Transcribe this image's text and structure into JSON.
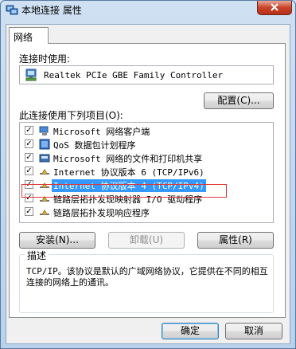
{
  "window": {
    "title": "本地连接 属性"
  },
  "tabs": [
    {
      "label": "网络"
    }
  ],
  "connect_using": {
    "label": "连接时使用:",
    "adapter": "Realtek PCIe GBE Family Controller",
    "configure_button": "配置(C)..."
  },
  "items_section": {
    "label": "此连接使用下列项目(O):",
    "items": [
      {
        "label": "Microsoft 网络客户端",
        "checked": true,
        "icon": "network-client-icon"
      },
      {
        "label": "QoS 数据包计划程序",
        "checked": true,
        "icon": "qos-icon"
      },
      {
        "label": "Microsoft 网络的文件和打印机共享",
        "checked": true,
        "icon": "file-share-icon"
      },
      {
        "label": "Internet 协议版本 6 (TCP/IPv6)",
        "checked": true,
        "icon": "protocol-icon"
      },
      {
        "label": "Internet 协议版本 4 (TCP/IPv4)",
        "checked": true,
        "icon": "protocol-icon",
        "selected": true
      },
      {
        "label": "链路层拓扑发现映射器 I/O 驱动程序",
        "checked": true,
        "icon": "protocol-icon"
      },
      {
        "label": "链路层拓扑发现响应程序",
        "checked": true,
        "icon": "protocol-icon"
      }
    ]
  },
  "buttons": {
    "install": "安装(N)...",
    "uninstall": "卸载(U)",
    "properties": "属性(R)",
    "ok": "确定",
    "cancel": "取消"
  },
  "description": {
    "title": "描述",
    "text": "TCP/IP。该协议是默认的广域网络协议，它提供在不同的相互连接的网络上的通讯。"
  },
  "colors": {
    "selection": "#3399ff",
    "highlight_border": "#e03535",
    "close_button": "#c9442b"
  }
}
